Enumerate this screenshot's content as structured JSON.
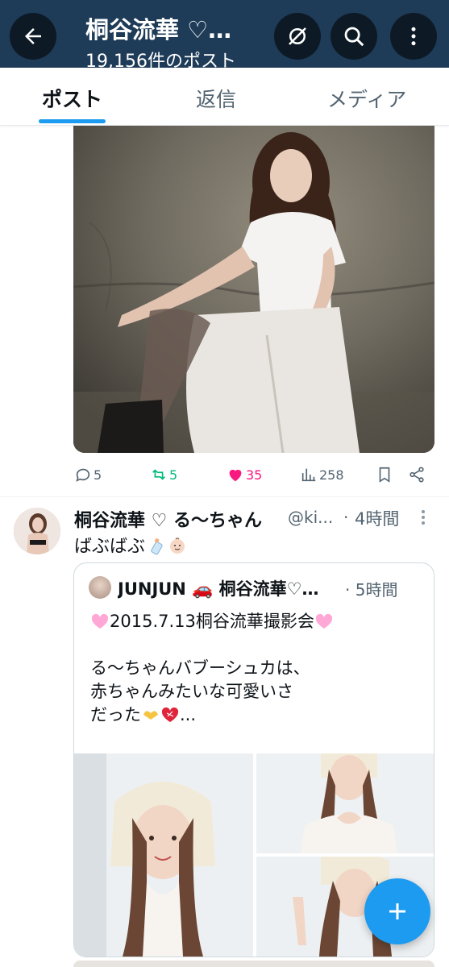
{
  "header": {
    "title": "桐谷流華 ♡…",
    "subtitle": "19,156件のポスト",
    "back_icon": "arrow-left-icon",
    "hide_icon": "eye-off-icon",
    "search_icon": "search-icon",
    "more_icon": "more-vertical-icon",
    "bg_color": "#1e3b57"
  },
  "tabs": [
    {
      "label": "ポスト",
      "active": true
    },
    {
      "label": "返信",
      "active": false
    },
    {
      "label": "メディア",
      "active": false
    }
  ],
  "post1": {
    "reply_count": "5",
    "repost_count": "5",
    "like_count": "35",
    "view_count": "258"
  },
  "post2": {
    "author": "桐谷流華 ♡ る〜ちゃん",
    "handle": "@ki...",
    "separator": "·",
    "time": "4時間",
    "text": "ばぶばぶ",
    "quote": {
      "author": "JUNJUN 🚗 桐谷流華♡…",
      "separator": "·",
      "time": "5時間",
      "line1": "2015.7.13桐谷流華撮影会",
      "line2": "る〜ちゃんバブーシュカは、",
      "line3": "赤ちゃんみたいな可愛いさ",
      "line4": "だった"
    }
  },
  "fab": {
    "icon": "plus-icon"
  },
  "colors": {
    "accent": "#1d9bf0",
    "like": "#f91880",
    "repost": "#00ba7c",
    "muted": "#536471"
  }
}
